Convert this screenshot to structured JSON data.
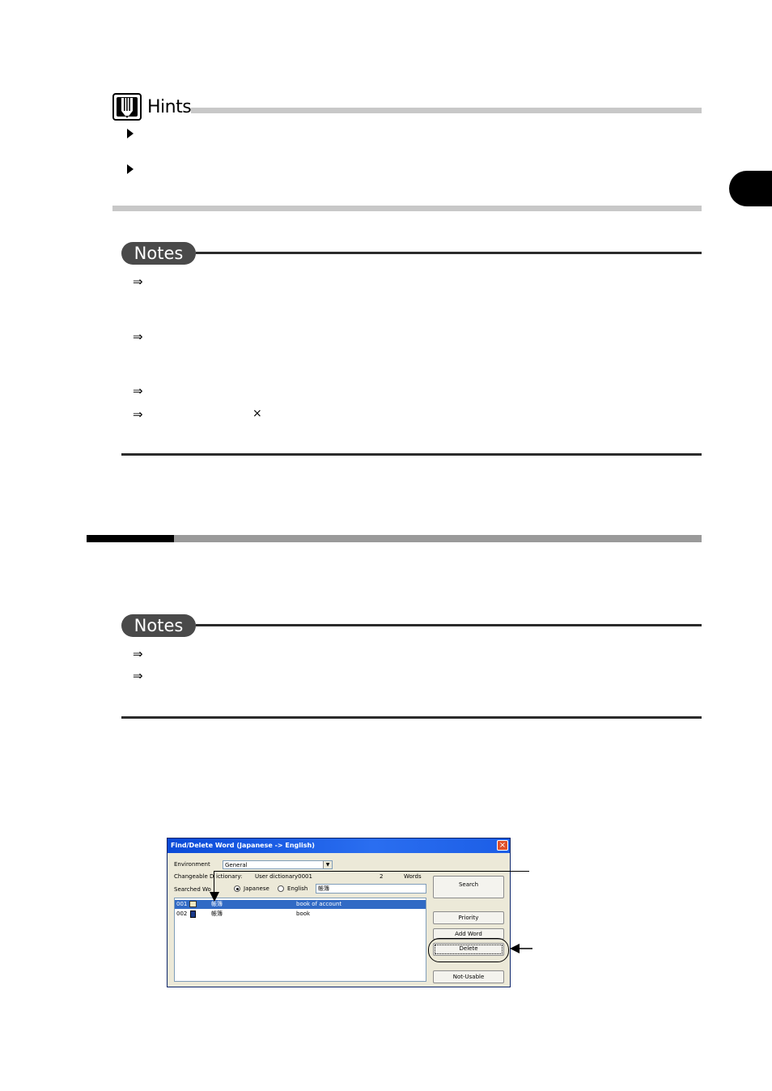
{
  "hints": {
    "title": "Hints"
  },
  "dialog": {
    "title": "Find/Delete Word (Japanese -> English)",
    "close": "×",
    "environment_label": "Environment",
    "environment_value": "General",
    "changeable_label": "Changeable D",
    "changeable_rest": "ictionary:",
    "dictionary_name": "User dictionary0001",
    "word_count": "2",
    "words_label": "Words",
    "searched_label": "Searched Wo",
    "radio_japanese": "Japanese",
    "radio_english": "English",
    "search_text": "帳簿",
    "rows": [
      {
        "num": "001",
        "src": "帳簿",
        "dst": "book of account"
      },
      {
        "num": "002",
        "src": "帳簿",
        "dst": "book"
      }
    ],
    "buttons": {
      "search": "Search",
      "priority": "Priority",
      "add_word": "Add Word",
      "delete": "Delete",
      "not_usable": "Not-Usable"
    }
  },
  "notes": {
    "label": "Notes",
    "arrow": "⇒",
    "times": "×"
  },
  "colors": {
    "hints_rule": "#c8c8c8",
    "notes_badge": "#4a4a4a",
    "section_gray": "#9a9a9a",
    "selection": "#316ac5",
    "titlebar": "#0a4ad8"
  }
}
